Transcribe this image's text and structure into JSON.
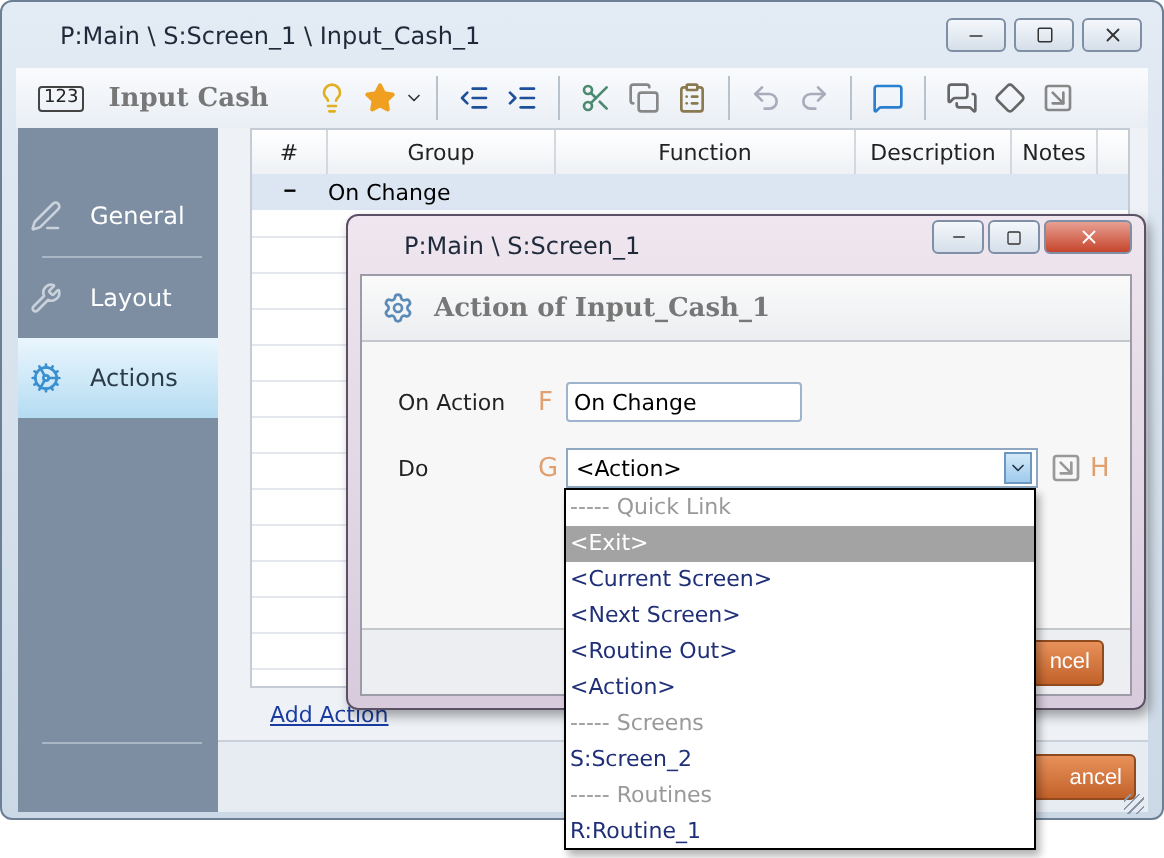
{
  "window": {
    "title": "P:Main \\ S:Screen_1 \\ Input_Cash_1"
  },
  "toolbar": {
    "badge": "123",
    "title": "Input Cash"
  },
  "sidebar": {
    "items": [
      {
        "label": "General",
        "selected": false
      },
      {
        "label": "Layout",
        "selected": false
      },
      {
        "label": "Actions",
        "selected": true
      }
    ]
  },
  "table": {
    "columns": [
      "#",
      "Group",
      "Function",
      "Description",
      "Notes"
    ],
    "groups": [
      {
        "toggle": "−",
        "label": "On Change"
      }
    ]
  },
  "add_action": "Add Action",
  "footer": {
    "cancel": "ancel"
  },
  "dialog": {
    "title": "P:Main \\ S:Screen_1",
    "header": "Action of Input_Cash_1",
    "fields": [
      {
        "kind": "text",
        "label": "On Action",
        "key": "F",
        "value": "On Change"
      },
      {
        "kind": "select",
        "label": "Do",
        "key": "G",
        "value": "<Action>",
        "extra_key": "H"
      }
    ],
    "cancel": "ncel"
  },
  "dropdown": {
    "items": [
      {
        "kind": "header",
        "label": "----- Quick Link",
        "selected": false
      },
      {
        "kind": "option",
        "label": "<Exit>",
        "selected": true
      },
      {
        "kind": "option",
        "label": "<Current Screen>",
        "selected": false
      },
      {
        "kind": "option",
        "label": "<Next Screen>",
        "selected": false
      },
      {
        "kind": "option",
        "label": "<Routine Out>",
        "selected": false
      },
      {
        "kind": "option",
        "label": "<Action>",
        "selected": false
      },
      {
        "kind": "header",
        "label": "----- Screens",
        "selected": false
      },
      {
        "kind": "option",
        "label": "S:Screen_2",
        "selected": false
      },
      {
        "kind": "header",
        "label": "----- Routines",
        "selected": false
      },
      {
        "kind": "option",
        "label": "R:Routine_1",
        "selected": false
      }
    ]
  }
}
